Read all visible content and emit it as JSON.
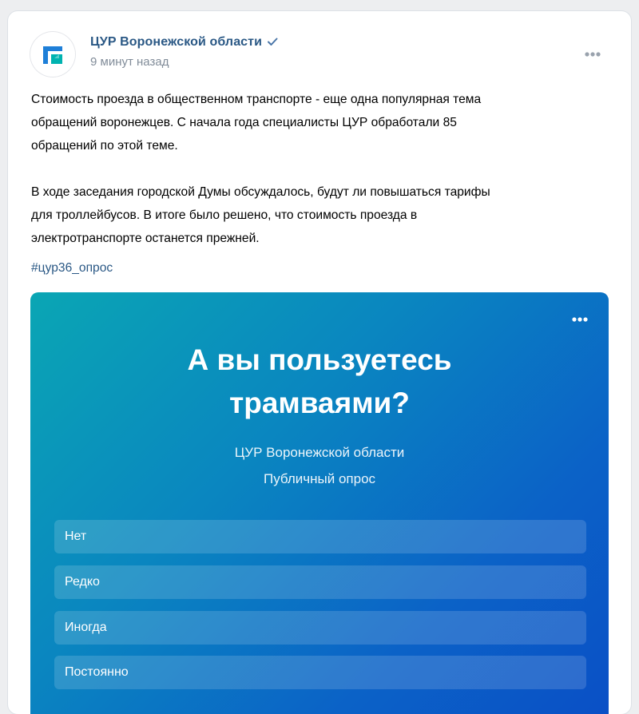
{
  "post": {
    "author": "ЦУР Воронежской области",
    "time": "9 минут назад",
    "paragraph1": [
      "Стоимость проезда в общественном транспорте - еще одна популярная тема",
      "обращений воронежцев. С начала года специалисты ЦУР обработали 85",
      "обращений по этой теме."
    ],
    "paragraph2": [
      "В ходе заседания городской Думы обсуждалось, будут ли повышаться тарифы",
      "для троллейбусов. В итоге было решено, что стоимость проезда в",
      "электротранспорте останется прежней."
    ],
    "hashtag": "#цур36_опрос"
  },
  "poll": {
    "title_line1": "А вы пользуетесь",
    "title_line2": "трамваями?",
    "author": "ЦУР Воронежской области",
    "type": "Публичный опрос",
    "options": [
      {
        "label": "Нет"
      },
      {
        "label": "Редко"
      },
      {
        "label": "Иногда"
      },
      {
        "label": "Постоянно"
      }
    ],
    "gradient": [
      "#0aa6b4",
      "#0a86c0",
      "#0b62c7",
      "#0a4fc6"
    ]
  },
  "icons": {
    "avatar_logo": "cur-logo-icon",
    "verified": "verified-check-icon",
    "post_more": "more-horizontal-icon",
    "poll_more": "more-horizontal-icon"
  },
  "colors": {
    "link": "#2a5885",
    "secondary": "#818c99",
    "page_bg": "#edeef0",
    "logo_teal": "#00b3b0",
    "logo_blue": "#1e7fd8"
  }
}
